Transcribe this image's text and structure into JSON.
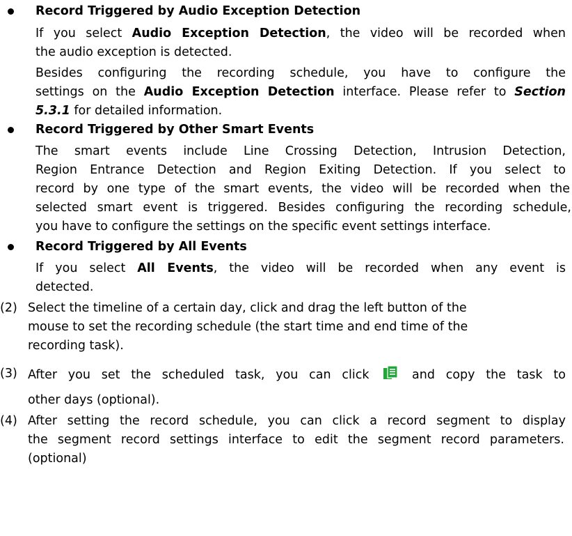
{
  "bullets": [
    {
      "title": "Record Triggered by Audio Exception Detection",
      "p1_line1_a": "If you select ",
      "p1_line1_b": "Audio Exception Detection",
      "p1_line1_c": ", the video will be recorded when",
      "p1_line2": "the audio exception is detected.",
      "p2_line1": "Besides configuring the recording schedule, you have to configure the",
      "p2_line2_a": "settings on the ",
      "p2_line2_b": "Audio Exception Detection",
      "p2_line2_c": " interface. Please refer to ",
      "p2_line2_d": "Section",
      "p2_line3_a": "5.3.1",
      "p2_line3_b": " for detailed information."
    },
    {
      "title": "Record Triggered by Other Smart Events",
      "lines": [
        "The smart events include Line Crossing Detection, Intrusion Detection,",
        "Region Entrance Detection and Region Exiting Detection. If you select to",
        "record by one type of the smart events, the video will be recorded when the",
        "selected smart event is triggered. Besides configuring the recording schedule,",
        "you have to configure the settings on the specific event settings interface."
      ]
    },
    {
      "title": "Record Triggered by All Events",
      "line1_a": "If you select ",
      "line1_b": "All Events",
      "line1_c": ", the video will be recorded when any event is",
      "line2": "detected."
    }
  ],
  "steps": [
    {
      "num": "(2)",
      "lines": [
        "Select the timeline of a certain day, click and drag the left button of the",
        "mouse to set the recording schedule (the start time and end time of the",
        "recording task)."
      ]
    },
    {
      "num": "(3)",
      "line1_a": "After you set the scheduled task, you can click",
      "line1_b": "and copy the task to",
      "line2": "other days (optional)."
    },
    {
      "num": "(4)",
      "lines": [
        "After setting the record schedule, you can click a record segment to display",
        "the segment record settings interface to edit the segment record parameters.",
        "(optional)"
      ]
    }
  ],
  "icons": {
    "copy": "copy-icon"
  },
  "colors": {
    "icon_green": "#22a63a",
    "text": "#000000"
  }
}
